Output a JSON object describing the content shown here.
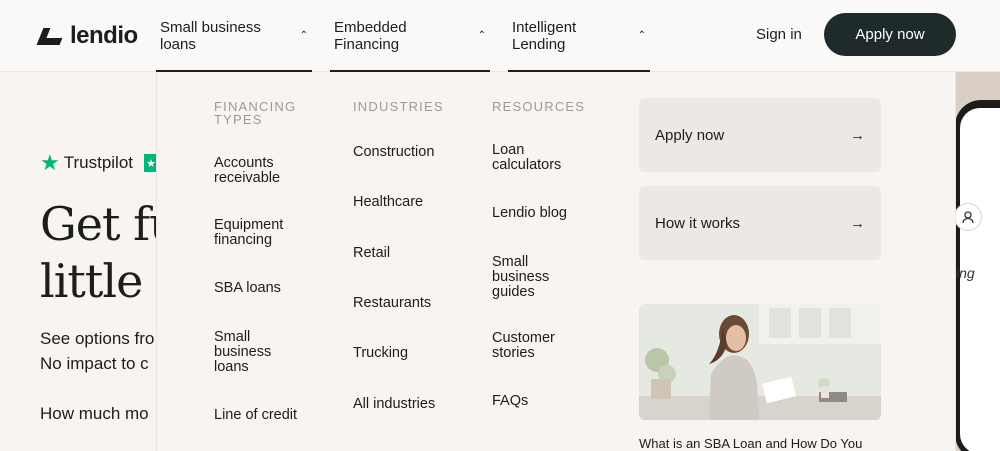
{
  "brand": {
    "name": "lendio"
  },
  "nav": {
    "items": [
      {
        "label": "Small business loans",
        "chevron": "chevron-up-icon"
      },
      {
        "label": "Embedded Financing",
        "chevron": "chevron-up-icon"
      },
      {
        "label": "Intelligent Lending",
        "chevron": "chevron-up-icon"
      }
    ],
    "signin": "Sign in",
    "apply": "Apply now"
  },
  "hero": {
    "trustpilot": "Trustpilot",
    "title_line1": "Get fu",
    "title_line2": "little",
    "sub_line1": "See options fro",
    "sub_line2": "No impact to c",
    "question": "How much mo",
    "phone_text": "ing"
  },
  "menu": {
    "financing": {
      "heading": "FINANCING TYPES",
      "items": [
        "Accounts receivable",
        "Equipment financing",
        "SBA loans",
        "Small business loans",
        "Line of credit"
      ]
    },
    "industries": {
      "heading": "INDUSTRIES",
      "items": [
        "Construction",
        "Healthcare",
        "Retail",
        "Restaurants",
        "Trucking",
        "All industries"
      ]
    },
    "resources": {
      "heading": "RESOURCES",
      "items": [
        "Loan calculators",
        "Lendio blog",
        "Small business guides",
        "Customer stories",
        "FAQs"
      ]
    },
    "cards": [
      {
        "label": "Apply now",
        "icon": "arrow-right-icon"
      },
      {
        "label": "How it works",
        "icon": "arrow-right-icon"
      }
    ],
    "article": {
      "caption": "What is an SBA Loan and How Do You"
    }
  },
  "colors": {
    "accent_dark": "#1f2b2b",
    "trustpilot_green": "#00b67a",
    "background": "#f7f4f1"
  }
}
